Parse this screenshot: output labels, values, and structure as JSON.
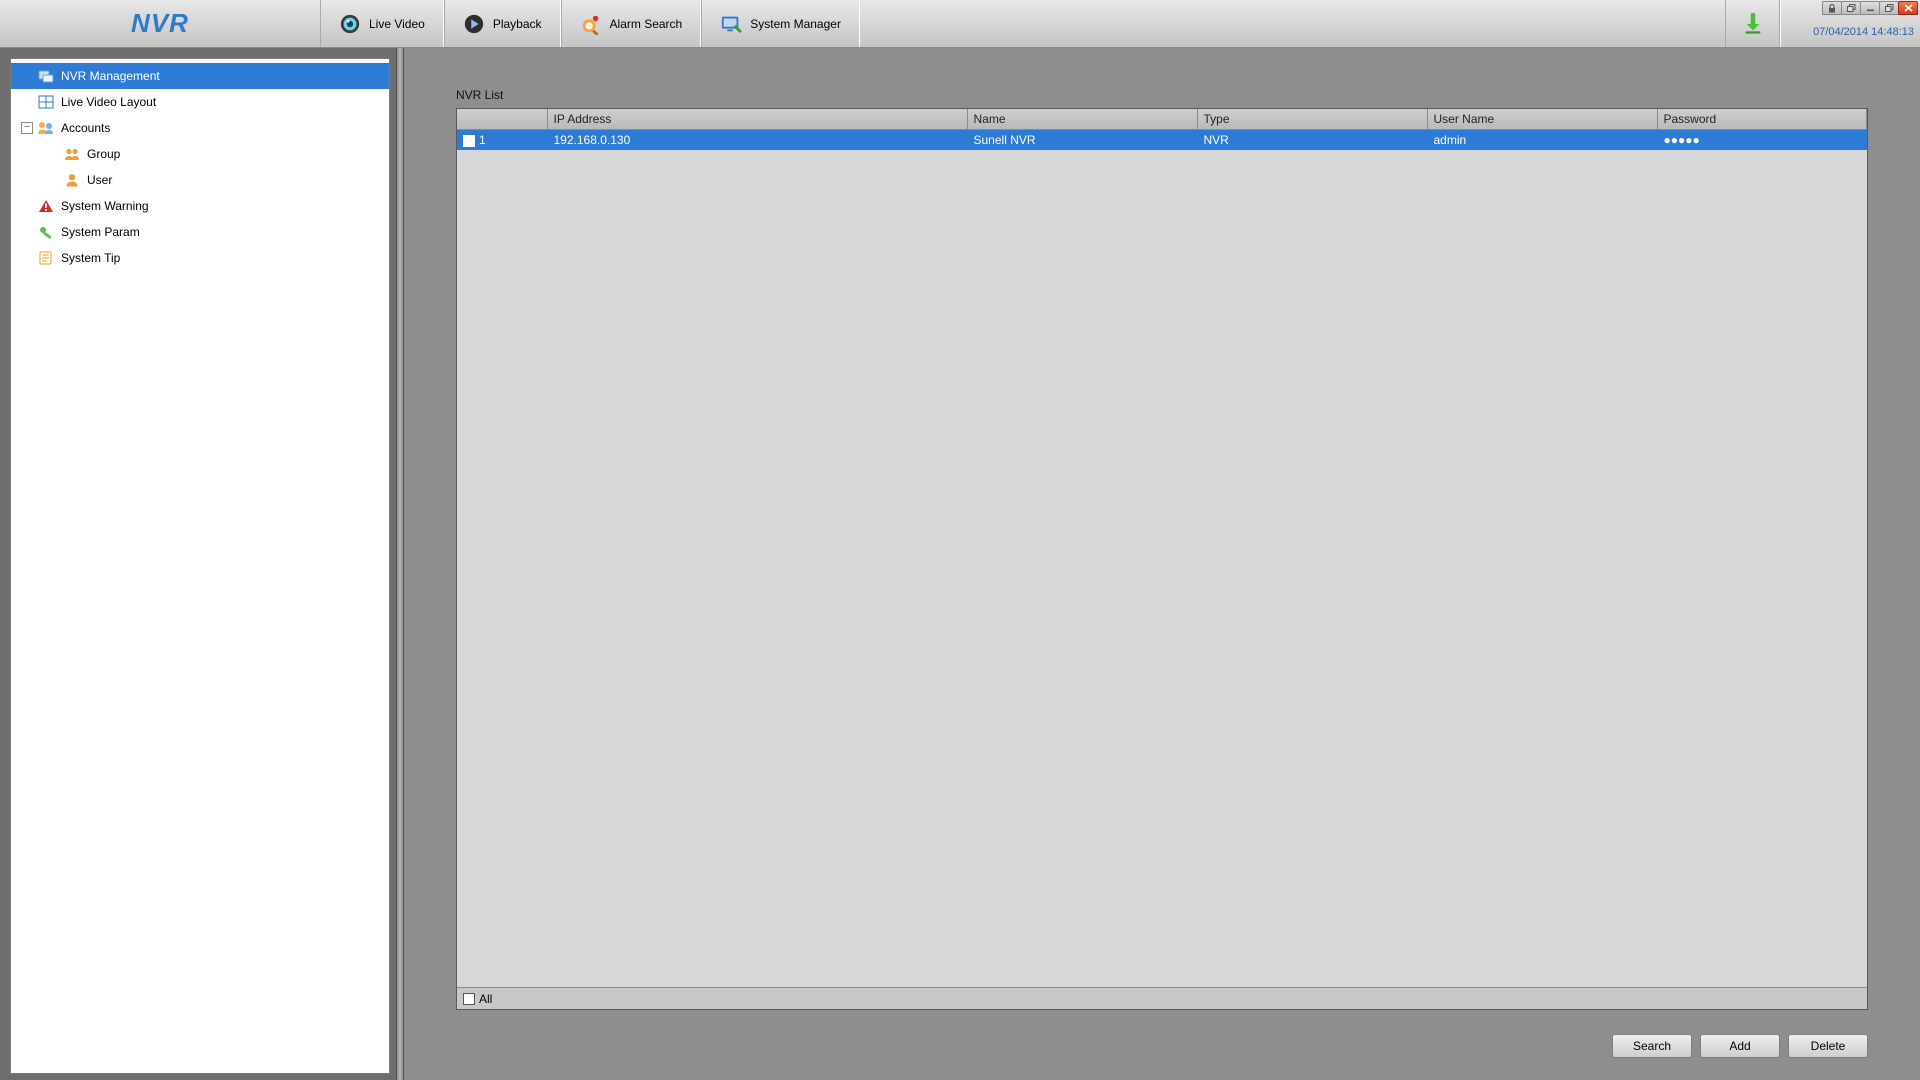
{
  "brand": "NVR",
  "nav": {
    "live_video": "Live Video",
    "playback": "Playback",
    "alarm_search": "Alarm Search",
    "system_manager": "System Manager"
  },
  "timestamp": "07/04/2014 14:48:13",
  "sidebar": {
    "nvr_management": "NVR Management",
    "live_video_layout": "Live Video Layout",
    "accounts": "Accounts",
    "group": "Group",
    "user": "User",
    "system_warning": "System Warning",
    "system_param": "System Param",
    "system_tip": "System Tip"
  },
  "table": {
    "title": "NVR List",
    "columns": {
      "ip": "IP Address",
      "name": "Name",
      "type": "Type",
      "user": "User Name",
      "password": "Password"
    },
    "rows": [
      {
        "index": "1",
        "checked": true,
        "ip": "192.168.0.130",
        "name": "Sunell NVR",
        "type": "NVR",
        "user": "admin",
        "password": "●●●●●"
      }
    ],
    "all_label": "All"
  },
  "buttons": {
    "search": "Search",
    "add": "Add",
    "delete": "Delete"
  }
}
